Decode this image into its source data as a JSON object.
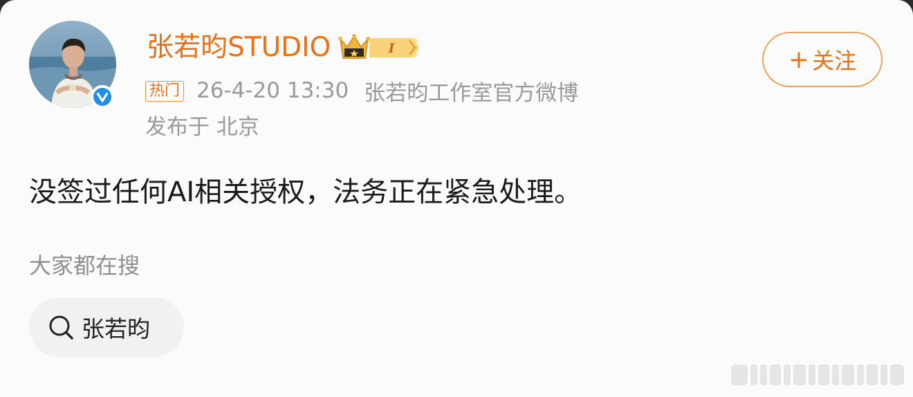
{
  "post": {
    "author": {
      "name": "张若昀STUDIO",
      "badge_level": "I",
      "verified": true
    },
    "tag": "热门",
    "time": "26-4-20 13:30",
    "source": "张若昀工作室官方微博",
    "location": "发布于 北京",
    "follow_button": {
      "plus": "+",
      "label": "关注"
    },
    "text": "没签过任何AI相关授权，法务正在紧急处理。"
  },
  "search": {
    "heading": "大家都在搜",
    "chips": [
      {
        "label": "张若昀",
        "icon": "search-icon"
      }
    ]
  },
  "colors": {
    "accent": "#ea7013",
    "meta_gray": "#999999",
    "verified_blue": "#1f8fe6",
    "chip_bg": "#f1f1f1"
  }
}
